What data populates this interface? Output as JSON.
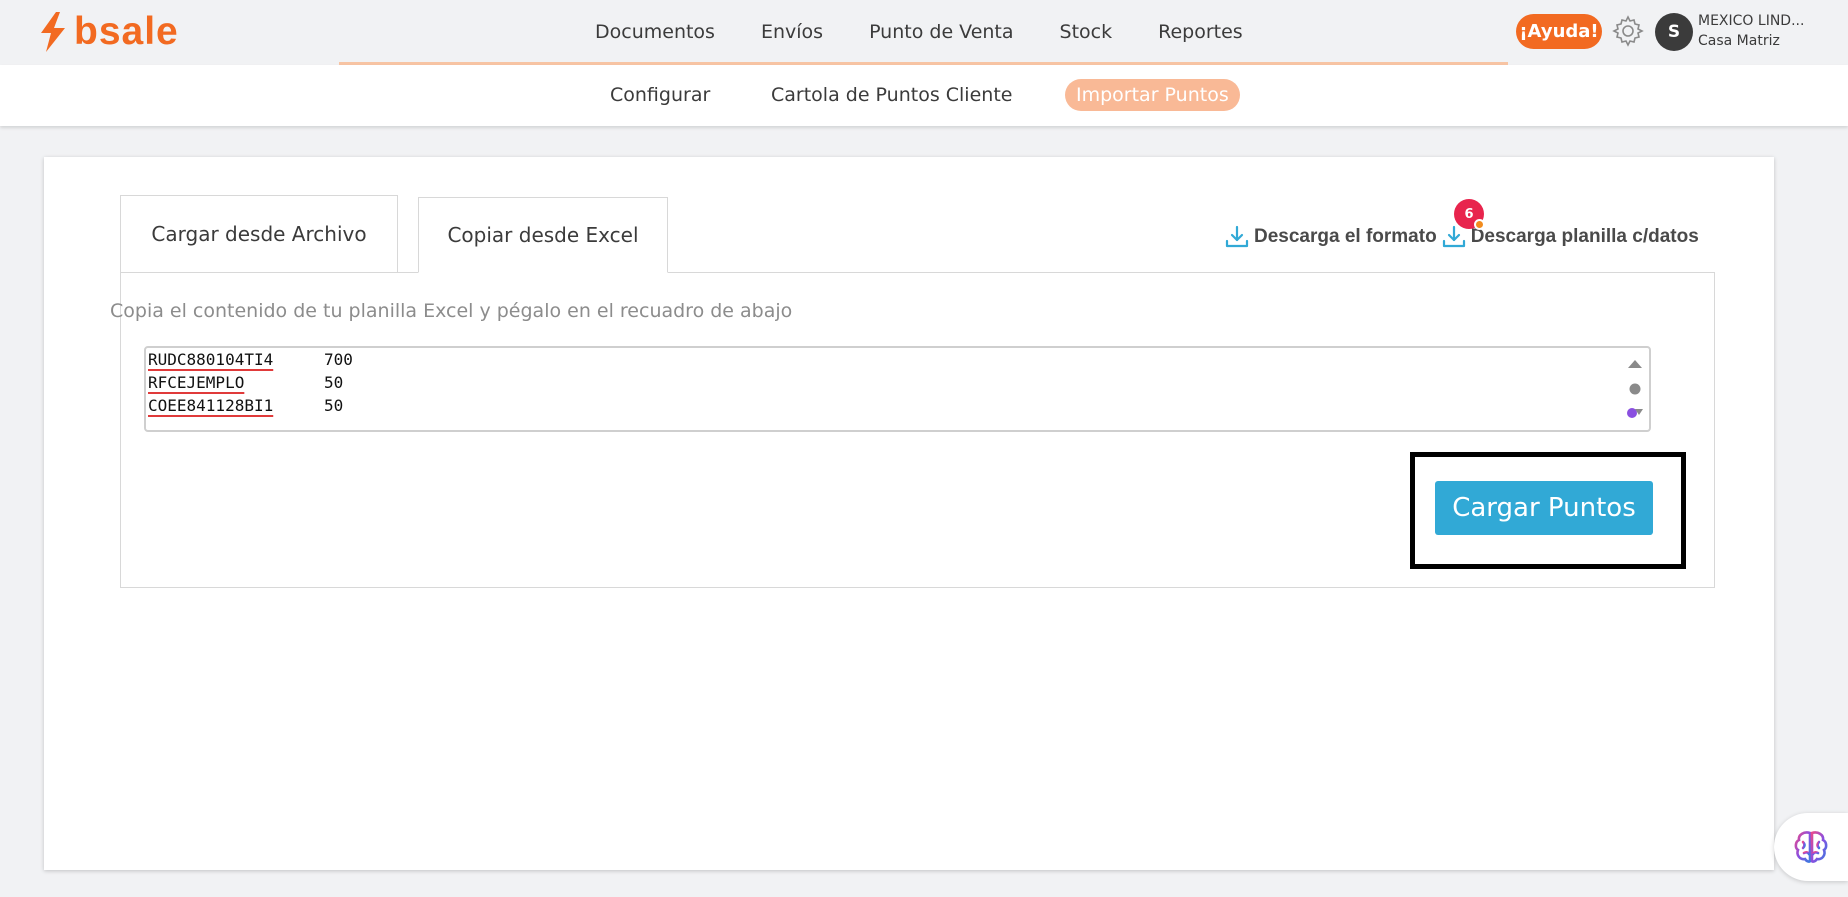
{
  "brand": {
    "logo_text": "bsale",
    "accent_color": "#f26a21"
  },
  "main_nav": {
    "items": [
      {
        "label": "Documentos"
      },
      {
        "label": "Envíos"
      },
      {
        "label": "Punto de Venta"
      },
      {
        "label": "Stock"
      },
      {
        "label": "Reportes"
      }
    ]
  },
  "header": {
    "help_label": "¡Ayuda!",
    "settings_icon": "gear-icon",
    "avatar_initial": "S",
    "account_name": "MEXICO LIND...",
    "account_branch": "Casa Matriz"
  },
  "sub_nav": {
    "items": [
      {
        "label": "Configurar",
        "active": false
      },
      {
        "label": "Cartola de Puntos Cliente",
        "active": false
      },
      {
        "label": "Importar Puntos",
        "active": true
      }
    ]
  },
  "tabs": {
    "file_label": "Cargar desde Archivo",
    "excel_label": "Copiar desde Excel",
    "active": "excel"
  },
  "downloads": {
    "format_label": "Descarga el formato",
    "data_label": "Descarga planilla c/datos",
    "icon": "download-icon"
  },
  "import_form": {
    "instructions": "Copia el contenido de tu planilla Excel y pégalo en el recuadro de abajo",
    "rows": [
      {
        "code": "RUDC880104TI4",
        "points": "700"
      },
      {
        "code": "RFCEJEMPLO",
        "points": "50"
      },
      {
        "code": "COEE841128BI1",
        "points": "50"
      }
    ],
    "badge_count": "6",
    "submit_label": "Cargar Puntos"
  },
  "floating_helper": {
    "icon": "brain-icon"
  }
}
